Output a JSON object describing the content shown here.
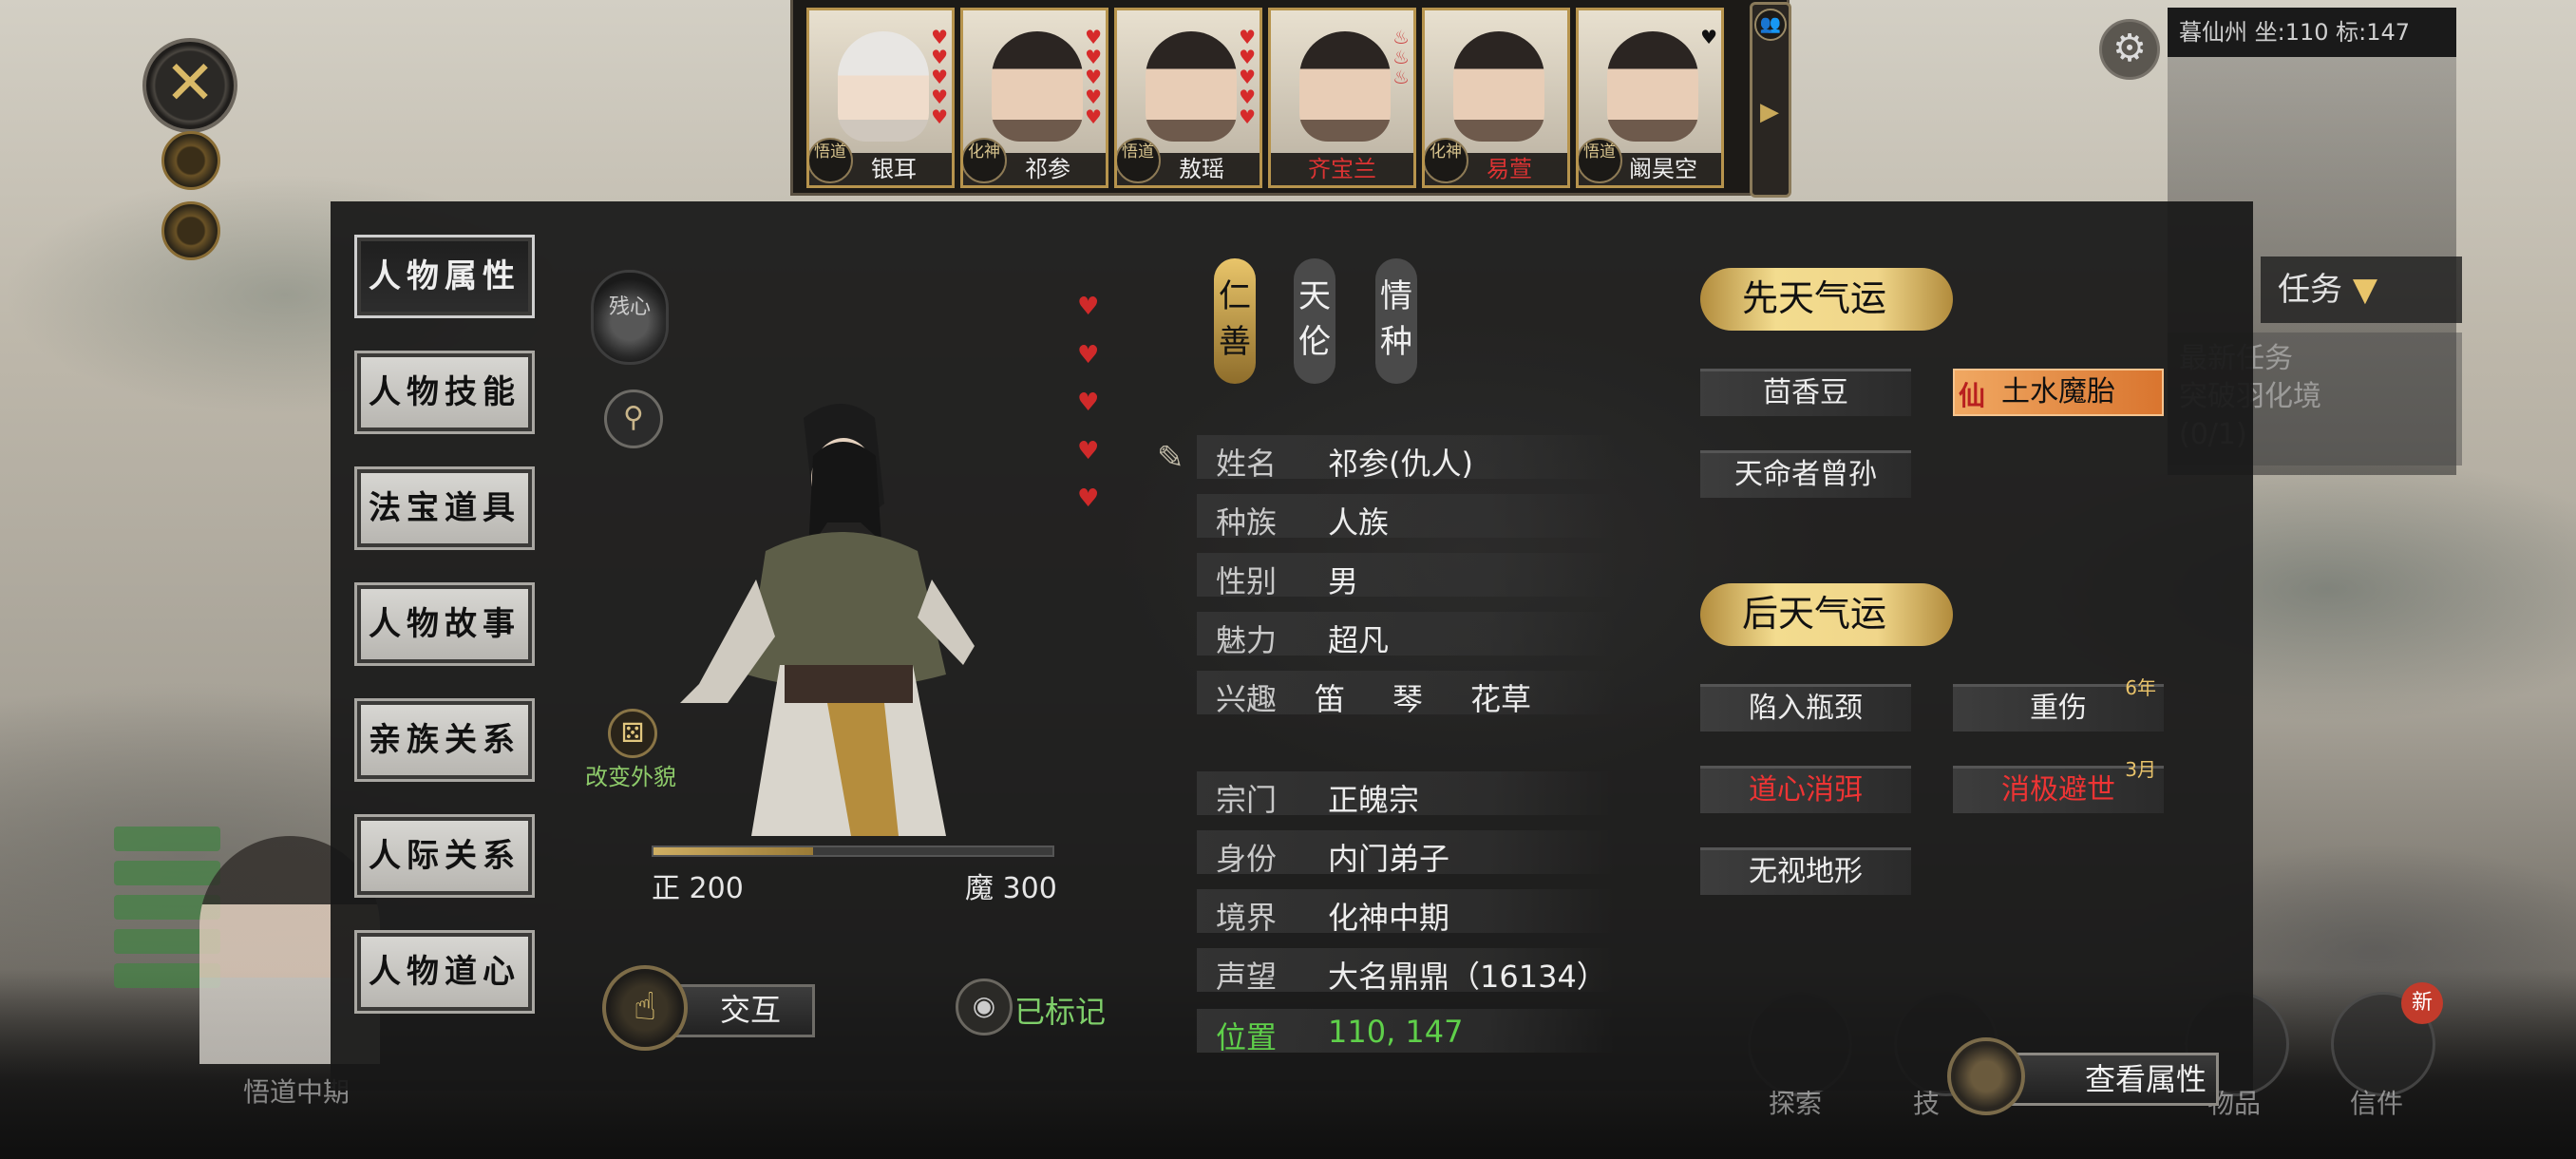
{
  "roster": [
    {
      "realm": "悟道",
      "name": "银耳",
      "hearts": 5,
      "name_color": "normal"
    },
    {
      "realm": "化神",
      "name": "祁参",
      "hearts": 5,
      "name_color": "normal"
    },
    {
      "realm": "悟道",
      "name": "敖瑶",
      "hearts": 5,
      "name_color": "normal"
    },
    {
      "realm": "化神",
      "name": "齐宝兰",
      "hearts": 0,
      "name_color": "red"
    },
    {
      "realm": "化神",
      "name": "易萱",
      "hearts": 0,
      "name_color": "red"
    },
    {
      "realm": "悟道",
      "name": "阚昊空",
      "hearts": 1,
      "name_color": "normal"
    }
  ],
  "menu": {
    "items": [
      "人物属性",
      "人物技能",
      "法宝道具",
      "人物故事",
      "亲族关系",
      "人际关系",
      "人物道心"
    ],
    "active_index": 0
  },
  "portrait": {
    "dao_badge": "残心",
    "change_look": "改变外貌",
    "zheng_label": "正 200",
    "mo_label": "魔 300",
    "zheng_fraction": 0.4,
    "hearts": 5
  },
  "interact": {
    "label": "交互"
  },
  "marked": {
    "label": "已标记"
  },
  "tabs": [
    "仁善",
    "天伦",
    "情种"
  ],
  "info": {
    "name": {
      "k": "姓名",
      "v": "祁参(仇人)"
    },
    "race": {
      "k": "种族",
      "v": "人族"
    },
    "gender": {
      "k": "性别",
      "v": "男"
    },
    "charm": {
      "k": "魅力",
      "v": "超凡"
    },
    "hobby": {
      "k": "兴趣",
      "v": [
        "笛",
        "琴",
        "花草"
      ]
    },
    "sect": {
      "k": "宗门",
      "v": "正魄宗"
    },
    "identity": {
      "k": "身份",
      "v": "内门弟子"
    },
    "realm": {
      "k": "境界",
      "v": "化神中期"
    },
    "fame": {
      "k": "声望",
      "v": "大名鼎鼎（16134）"
    },
    "location": {
      "k": "位置",
      "v": "110, 147"
    }
  },
  "innate": {
    "title": "先天气运",
    "tags": [
      {
        "label": "茴香豆",
        "style": "normal"
      },
      {
        "label": "土水魔胎",
        "style": "orange",
        "prefix": "仙"
      },
      {
        "label": "天命者曾孙",
        "style": "normal"
      }
    ]
  },
  "acquired": {
    "title": "后天气运",
    "tags": [
      {
        "label": "陷入瓶颈",
        "style": "normal"
      },
      {
        "label": "重伤",
        "style": "normal",
        "duration": "6年"
      },
      {
        "label": "道心消弭",
        "style": "red"
      },
      {
        "label": "消极避世",
        "style": "red",
        "duration": "3月"
      },
      {
        "label": "无视地形",
        "style": "normal"
      }
    ]
  },
  "map_ui": {
    "region_text": "暮仙州 坐:110 标:147",
    "task_header": "任务",
    "task_text_1": "最新任务",
    "task_text_2": "突破羽化境",
    "task_text_3": "(0/1)",
    "view_attr": "查看属性",
    "new_badge": "新",
    "bottom_labels": [
      "探索",
      "技",
      "物品",
      "信件"
    ],
    "avatar_status": "悟道中期"
  },
  "colors": {
    "accent_gold": "#e9c56a",
    "hearts": "#d02a2a",
    "positive_green": "#5fd04a",
    "negative_red": "#ee3434",
    "panel_bg": "#181818"
  },
  "icons": [
    "close-icon",
    "heart-icon",
    "search-icon",
    "dice-icon",
    "hand-icon",
    "eye-icon",
    "gear-icon",
    "people-icon",
    "play-arrow-icon",
    "brush-edit-icon"
  ]
}
